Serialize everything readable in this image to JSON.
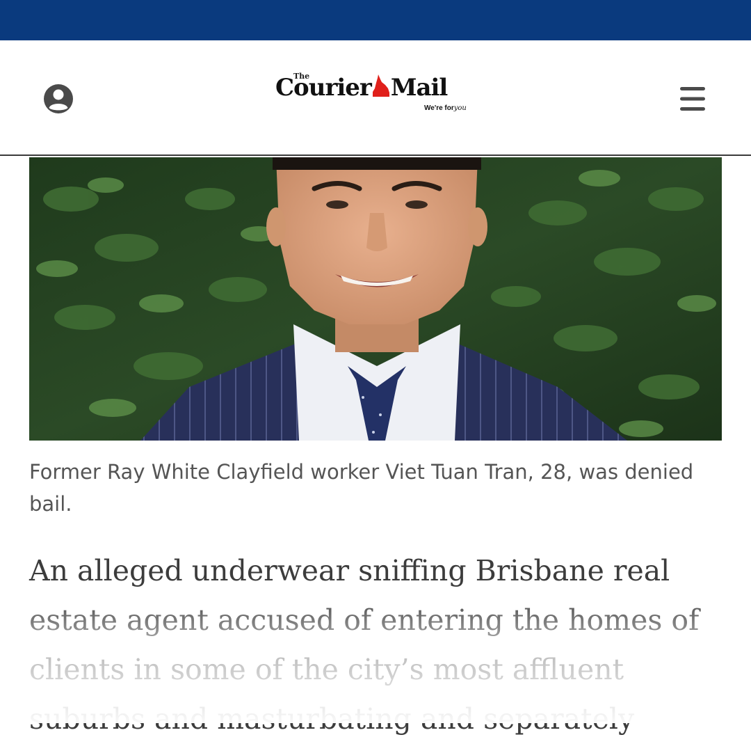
{
  "header": {
    "logo": {
      "prefix": "The",
      "part1": "Courier",
      "part2": "Mail",
      "tagline_prefix": "We're for",
      "tagline_script": "you"
    },
    "account_icon": "user-circle-icon",
    "menu_icon": "hamburger-menu-icon",
    "colors": {
      "top_bar": "#0a3a7e",
      "logo_accent": "#e0201b"
    }
  },
  "article": {
    "caption": "Former Ray White Clayfield worker Viet Tuan Tran, 28, was denied bail.",
    "body": "An alleged underwear sniffing Brisbane real estate agent accused of entering the homes of clients in some of the city’s most affluent suburbs and masturbating and separately"
  }
}
